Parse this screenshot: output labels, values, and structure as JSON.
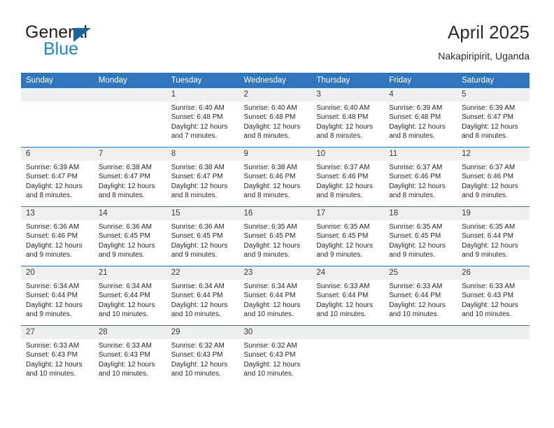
{
  "brand": {
    "name_part1": "General",
    "name_part2": "Blue",
    "logo_icon": "triangle-logo-icon"
  },
  "header": {
    "title": "April 2025",
    "subtitle": "Nakapiripirit, Uganda"
  },
  "colors": {
    "header_blue": "#2f76bb",
    "brand_blue": "#1886d4",
    "logo_blue": "#15659f",
    "daynum_bg": "#efefef"
  },
  "weekday_headers": [
    "Sunday",
    "Monday",
    "Tuesday",
    "Wednesday",
    "Thursday",
    "Friday",
    "Saturday"
  ],
  "weeks": [
    [
      {
        "day": "",
        "empty": true
      },
      {
        "day": "",
        "empty": true
      },
      {
        "day": "1",
        "sunrise": "Sunrise: 6:40 AM",
        "sunset": "Sunset: 6:48 PM",
        "daylight_1": "Daylight: 12 hours",
        "daylight_2": "and 7 minutes."
      },
      {
        "day": "2",
        "sunrise": "Sunrise: 6:40 AM",
        "sunset": "Sunset: 6:48 PM",
        "daylight_1": "Daylight: 12 hours",
        "daylight_2": "and 8 minutes."
      },
      {
        "day": "3",
        "sunrise": "Sunrise: 6:40 AM",
        "sunset": "Sunset: 6:48 PM",
        "daylight_1": "Daylight: 12 hours",
        "daylight_2": "and 8 minutes."
      },
      {
        "day": "4",
        "sunrise": "Sunrise: 6:39 AM",
        "sunset": "Sunset: 6:48 PM",
        "daylight_1": "Daylight: 12 hours",
        "daylight_2": "and 8 minutes."
      },
      {
        "day": "5",
        "sunrise": "Sunrise: 6:39 AM",
        "sunset": "Sunset: 6:47 PM",
        "daylight_1": "Daylight: 12 hours",
        "daylight_2": "and 8 minutes."
      }
    ],
    [
      {
        "day": "6",
        "sunrise": "Sunrise: 6:39 AM",
        "sunset": "Sunset: 6:47 PM",
        "daylight_1": "Daylight: 12 hours",
        "daylight_2": "and 8 minutes."
      },
      {
        "day": "7",
        "sunrise": "Sunrise: 6:38 AM",
        "sunset": "Sunset: 6:47 PM",
        "daylight_1": "Daylight: 12 hours",
        "daylight_2": "and 8 minutes."
      },
      {
        "day": "8",
        "sunrise": "Sunrise: 6:38 AM",
        "sunset": "Sunset: 6:47 PM",
        "daylight_1": "Daylight: 12 hours",
        "daylight_2": "and 8 minutes."
      },
      {
        "day": "9",
        "sunrise": "Sunrise: 6:38 AM",
        "sunset": "Sunset: 6:46 PM",
        "daylight_1": "Daylight: 12 hours",
        "daylight_2": "and 8 minutes."
      },
      {
        "day": "10",
        "sunrise": "Sunrise: 6:37 AM",
        "sunset": "Sunset: 6:46 PM",
        "daylight_1": "Daylight: 12 hours",
        "daylight_2": "and 8 minutes."
      },
      {
        "day": "11",
        "sunrise": "Sunrise: 6:37 AM",
        "sunset": "Sunset: 6:46 PM",
        "daylight_1": "Daylight: 12 hours",
        "daylight_2": "and 8 minutes."
      },
      {
        "day": "12",
        "sunrise": "Sunrise: 6:37 AM",
        "sunset": "Sunset: 6:46 PM",
        "daylight_1": "Daylight: 12 hours",
        "daylight_2": "and 9 minutes."
      }
    ],
    [
      {
        "day": "13",
        "sunrise": "Sunrise: 6:36 AM",
        "sunset": "Sunset: 6:46 PM",
        "daylight_1": "Daylight: 12 hours",
        "daylight_2": "and 9 minutes."
      },
      {
        "day": "14",
        "sunrise": "Sunrise: 6:36 AM",
        "sunset": "Sunset: 6:45 PM",
        "daylight_1": "Daylight: 12 hours",
        "daylight_2": "and 9 minutes."
      },
      {
        "day": "15",
        "sunrise": "Sunrise: 6:36 AM",
        "sunset": "Sunset: 6:45 PM",
        "daylight_1": "Daylight: 12 hours",
        "daylight_2": "and 9 minutes."
      },
      {
        "day": "16",
        "sunrise": "Sunrise: 6:35 AM",
        "sunset": "Sunset: 6:45 PM",
        "daylight_1": "Daylight: 12 hours",
        "daylight_2": "and 9 minutes."
      },
      {
        "day": "17",
        "sunrise": "Sunrise: 6:35 AM",
        "sunset": "Sunset: 6:45 PM",
        "daylight_1": "Daylight: 12 hours",
        "daylight_2": "and 9 minutes."
      },
      {
        "day": "18",
        "sunrise": "Sunrise: 6:35 AM",
        "sunset": "Sunset: 6:45 PM",
        "daylight_1": "Daylight: 12 hours",
        "daylight_2": "and 9 minutes."
      },
      {
        "day": "19",
        "sunrise": "Sunrise: 6:35 AM",
        "sunset": "Sunset: 6:44 PM",
        "daylight_1": "Daylight: 12 hours",
        "daylight_2": "and 9 minutes."
      }
    ],
    [
      {
        "day": "20",
        "sunrise": "Sunrise: 6:34 AM",
        "sunset": "Sunset: 6:44 PM",
        "daylight_1": "Daylight: 12 hours",
        "daylight_2": "and 9 minutes."
      },
      {
        "day": "21",
        "sunrise": "Sunrise: 6:34 AM",
        "sunset": "Sunset: 6:44 PM",
        "daylight_1": "Daylight: 12 hours",
        "daylight_2": "and 10 minutes."
      },
      {
        "day": "22",
        "sunrise": "Sunrise: 6:34 AM",
        "sunset": "Sunset: 6:44 PM",
        "daylight_1": "Daylight: 12 hours",
        "daylight_2": "and 10 minutes."
      },
      {
        "day": "23",
        "sunrise": "Sunrise: 6:34 AM",
        "sunset": "Sunset: 6:44 PM",
        "daylight_1": "Daylight: 12 hours",
        "daylight_2": "and 10 minutes."
      },
      {
        "day": "24",
        "sunrise": "Sunrise: 6:33 AM",
        "sunset": "Sunset: 6:44 PM",
        "daylight_1": "Daylight: 12 hours",
        "daylight_2": "and 10 minutes."
      },
      {
        "day": "25",
        "sunrise": "Sunrise: 6:33 AM",
        "sunset": "Sunset: 6:44 PM",
        "daylight_1": "Daylight: 12 hours",
        "daylight_2": "and 10 minutes."
      },
      {
        "day": "26",
        "sunrise": "Sunrise: 6:33 AM",
        "sunset": "Sunset: 6:43 PM",
        "daylight_1": "Daylight: 12 hours",
        "daylight_2": "and 10 minutes."
      }
    ],
    [
      {
        "day": "27",
        "sunrise": "Sunrise: 6:33 AM",
        "sunset": "Sunset: 6:43 PM",
        "daylight_1": "Daylight: 12 hours",
        "daylight_2": "and 10 minutes."
      },
      {
        "day": "28",
        "sunrise": "Sunrise: 6:33 AM",
        "sunset": "Sunset: 6:43 PM",
        "daylight_1": "Daylight: 12 hours",
        "daylight_2": "and 10 minutes."
      },
      {
        "day": "29",
        "sunrise": "Sunrise: 6:32 AM",
        "sunset": "Sunset: 6:43 PM",
        "daylight_1": "Daylight: 12 hours",
        "daylight_2": "and 10 minutes."
      },
      {
        "day": "30",
        "sunrise": "Sunrise: 6:32 AM",
        "sunset": "Sunset: 6:43 PM",
        "daylight_1": "Daylight: 12 hours",
        "daylight_2": "and 10 minutes."
      },
      {
        "day": "",
        "empty": true
      },
      {
        "day": "",
        "empty": true
      },
      {
        "day": "",
        "empty": true
      }
    ]
  ]
}
